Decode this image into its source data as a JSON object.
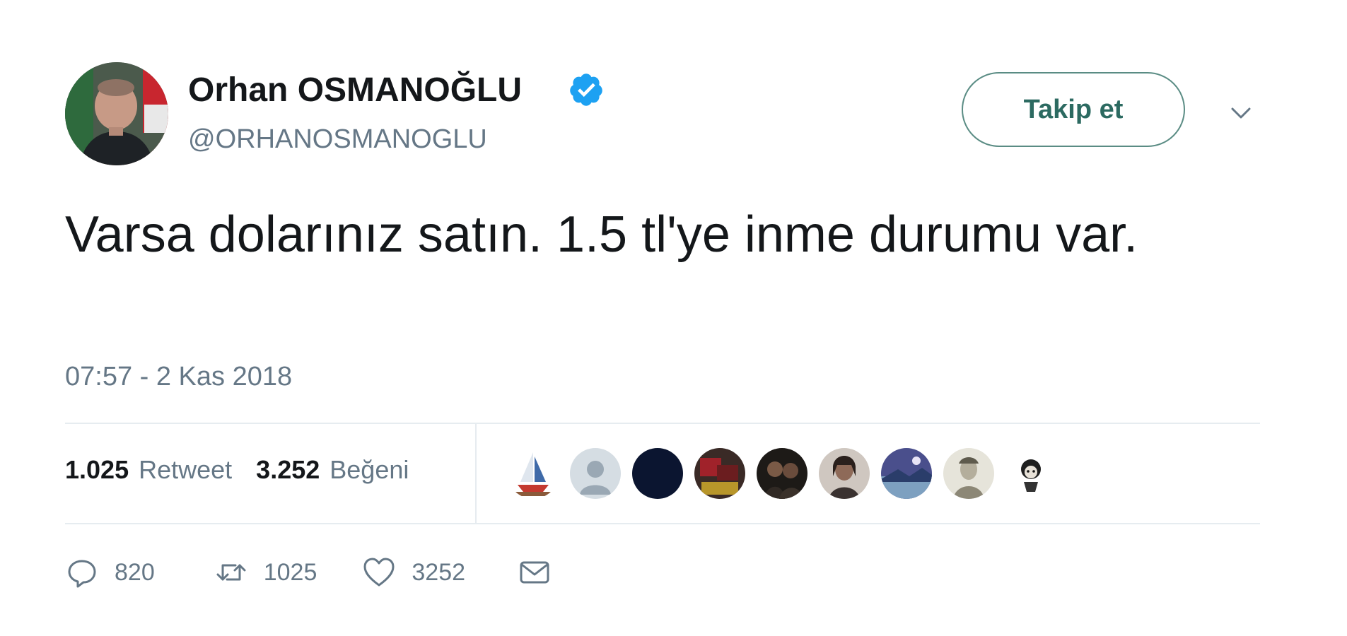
{
  "author": {
    "name": "Orhan OSMANOĞLU",
    "handle": "@ORHANOSMANOGLU",
    "verified": true,
    "avatar_icon": "profile-photo"
  },
  "follow_button": {
    "label": "Takip et"
  },
  "menu": {
    "icon": "chevron-down-icon"
  },
  "tweet": {
    "text": "Varsa dolarınız satın. 1.5 tl'ye inme durumu var.",
    "timestamp": "07:57 - 2 Kas 2018"
  },
  "stats": {
    "retweets_count": "1.025",
    "retweets_label": "Retweet",
    "likes_count": "3.252",
    "likes_label": "Beğeni"
  },
  "liked_by_avatars": [
    "avatar-sailboat",
    "avatar-default",
    "avatar-dark",
    "avatar-red",
    "avatar-people",
    "avatar-portrait",
    "avatar-landscape",
    "avatar-sketch",
    "avatar-cartoon"
  ],
  "actions": {
    "reply_count": "820",
    "retweet_count": "1025",
    "like_count": "3252"
  },
  "colors": {
    "text": "#14171a",
    "secondary_text": "#657786",
    "verified_blue": "#1da1f2",
    "follow_border": "#5a8c84",
    "divider": "#e6ecf0"
  }
}
